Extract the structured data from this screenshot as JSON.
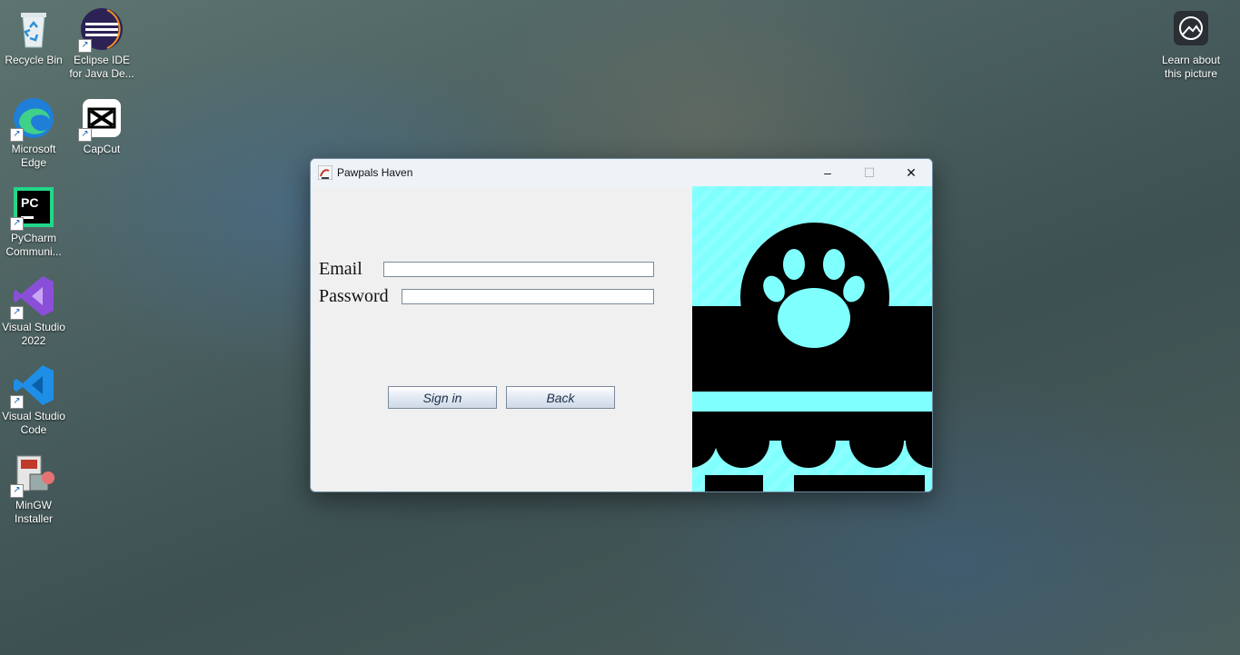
{
  "desktop": {
    "icons": [
      {
        "label": "Recycle Bin"
      },
      {
        "label": "Eclipse IDE for Java De..."
      },
      {
        "label": "Microsoft Edge"
      },
      {
        "label": "CapCut"
      },
      {
        "label": "PyCharm Communi..."
      },
      {
        "label": "Visual Studio 2022"
      },
      {
        "label": "Visual Studio Code"
      },
      {
        "label": "MinGW Installer"
      },
      {
        "label": "Learn about this picture"
      }
    ]
  },
  "window": {
    "title": "Pawpals Haven",
    "controls": {
      "minimize": "–",
      "maximize": "☐",
      "close": "✕"
    },
    "form": {
      "email_label": "Email",
      "email_value": "",
      "password_label": "Password",
      "password_value": "",
      "signin_label": "Sign in",
      "back_label": "Back"
    },
    "colors": {
      "accent_cyan": "#80ffff",
      "art_black": "#000000"
    }
  }
}
